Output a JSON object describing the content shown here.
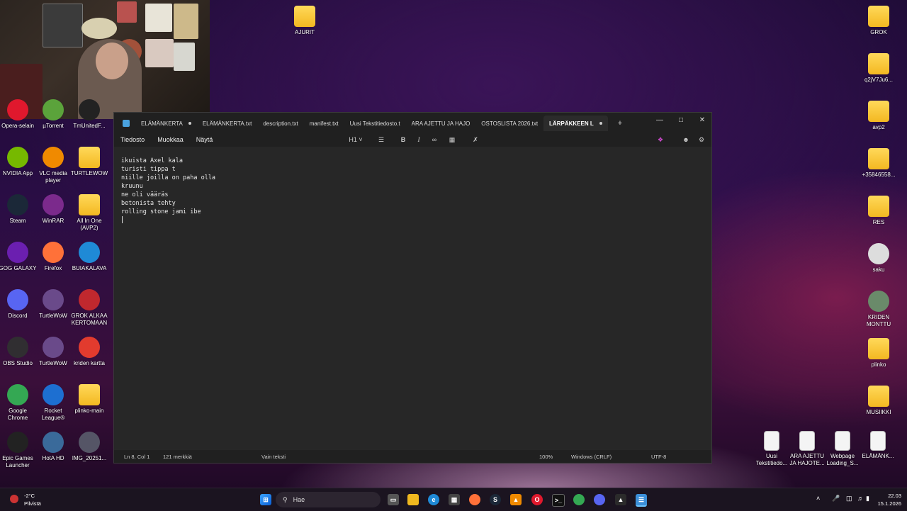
{
  "desktop_left": [
    {
      "label": "Opera-selain",
      "icon": "opera-icon",
      "color": "#e0182d"
    },
    {
      "label": "µTorrent",
      "icon": "utorrent-icon",
      "color": "#5ba33b"
    },
    {
      "label": "TmUnitedF...",
      "icon": "trackmania-icon",
      "color": "#222"
    },
    {
      "label": "NVIDIA App",
      "icon": "nvidia-icon",
      "color": "#76b900"
    },
    {
      "label": "VLC media player",
      "icon": "vlc-icon",
      "color": "#f08a00"
    },
    {
      "label": "TURTLEWOW",
      "icon": "folder-icon",
      "color": "folder"
    },
    {
      "label": "Steam",
      "icon": "steam-icon",
      "color": "#1b2838"
    },
    {
      "label": "WinRAR",
      "icon": "winrar-icon",
      "color": "#7b2a8c"
    },
    {
      "label": "All In One (AVP2)",
      "icon": "folder-icon",
      "color": "folder"
    },
    {
      "label": "GOG GALAXY",
      "icon": "gog-icon",
      "color": "#6b1fb0"
    },
    {
      "label": "Firefox",
      "icon": "firefox-icon",
      "color": "#ff7139"
    },
    {
      "label": "BUIAKALAVA",
      "icon": "edge-icon",
      "color": "#1f8ad6"
    },
    {
      "label": "Discord",
      "icon": "discord-icon",
      "color": "#5865f2"
    },
    {
      "label": "TurtleWoW",
      "icon": "turtlewow-icon",
      "color": "#6a4a8a"
    },
    {
      "label": "GROK ALKAA KERTOMAAN",
      "icon": "grok-shortcut-icon",
      "color": "#c0282e"
    },
    {
      "label": "OBS Studio",
      "icon": "obs-icon",
      "color": "#302e31"
    },
    {
      "label": "TurtleWoW",
      "icon": "turtlewow-icon",
      "color": "#6a4a8a"
    },
    {
      "label": "kriden kartta",
      "icon": "pdf-icon",
      "color": "#e23b2e"
    },
    {
      "label": "Google Chrome",
      "icon": "chrome-icon",
      "color": "#34a853"
    },
    {
      "label": "Rocket League®",
      "icon": "rocket-league-icon",
      "color": "#1d6fd1"
    },
    {
      "label": "plinko-main",
      "icon": "folder-icon",
      "color": "folder"
    },
    {
      "label": "Epic Games Launcher",
      "icon": "epic-icon",
      "color": "#222"
    },
    {
      "label": "HotA HD",
      "icon": "hota-icon",
      "color": "#3a6a9a"
    },
    {
      "label": "IMG_20251...",
      "icon": "image-icon",
      "color": "#556"
    }
  ],
  "desktop_right": [
    {
      "label": "GROK",
      "icon": "folder-icon",
      "color": "folder"
    },
    {
      "label": "q2jV7Ju6...",
      "icon": "folder-icon",
      "color": "folder"
    },
    {
      "label": "avp2",
      "icon": "folder-icon",
      "color": "folder"
    },
    {
      "label": "+35846558...",
      "icon": "folder-icon",
      "color": "folder"
    },
    {
      "label": "RES",
      "icon": "folder-icon",
      "color": "folder"
    },
    {
      "label": "saku",
      "icon": "image-icon",
      "color": "#ddd"
    },
    {
      "label": "KRIDEN MONTTU",
      "icon": "image-icon",
      "color": "#6a8a6a"
    },
    {
      "label": "plinko",
      "icon": "folder-icon",
      "color": "folder"
    },
    {
      "label": "MUSIIKKI",
      "icon": "folder-icon",
      "color": "folder"
    }
  ],
  "desktop_bottom_files": [
    {
      "label": "Uusi Tekstitiedo...",
      "icon": "text-file-icon"
    },
    {
      "label": "ARA AJETTU JA HAJOTE...",
      "icon": "text-file-icon"
    },
    {
      "label": "Webpage Loading_S...",
      "icon": "text-file-icon"
    },
    {
      "label": "ELÄMÄNK...",
      "icon": "text-file-icon"
    }
  ],
  "desktop_top": {
    "ajurit": "AJURIT"
  },
  "notepad": {
    "tabs": [
      {
        "label": "ELÄMÄNKERTA",
        "unsaved": true,
        "active": false
      },
      {
        "label": "ELÄMÄNKERTA.txt",
        "unsaved": false,
        "active": false
      },
      {
        "label": "description.txt",
        "unsaved": false,
        "active": false
      },
      {
        "label": "manifest.txt",
        "unsaved": false,
        "active": false
      },
      {
        "label": "Uusi Tekstitiedosto.t",
        "unsaved": false,
        "active": false
      },
      {
        "label": "ARA AJETTU JA HAJO",
        "unsaved": false,
        "active": false
      },
      {
        "label": "OSTOSLISTA 2026.txt",
        "unsaved": false,
        "active": false
      },
      {
        "label": "LÄRPÄKKEEN L",
        "unsaved": true,
        "active": true
      }
    ],
    "new_tab": "+",
    "menu": {
      "file": "Tiedosto",
      "edit": "Muokkaa",
      "view": "Näytä"
    },
    "toolbar": {
      "heading": "H1",
      "bold": "B",
      "italic": "I"
    },
    "lines": [
      "ikuista Axel kala",
      "turisti tippa t",
      "niille joilla on paha olla",
      "kruunu",
      "ne oli vääräs",
      "betonista tehty",
      "rolling stone jami ibe"
    ],
    "status": {
      "position": "Ln 8, Col 1",
      "chars": "121 merkkiä",
      "format": "Vain teksti",
      "zoom": "100%",
      "line_ending": "Windows (CRLF)",
      "encoding": "UTF-8"
    }
  },
  "taskbar": {
    "weather_temp": "-2°C",
    "weather_desc": "Pilvistä",
    "search_placeholder": "Hae",
    "time": "22.03",
    "date": "15.1.2026"
  }
}
